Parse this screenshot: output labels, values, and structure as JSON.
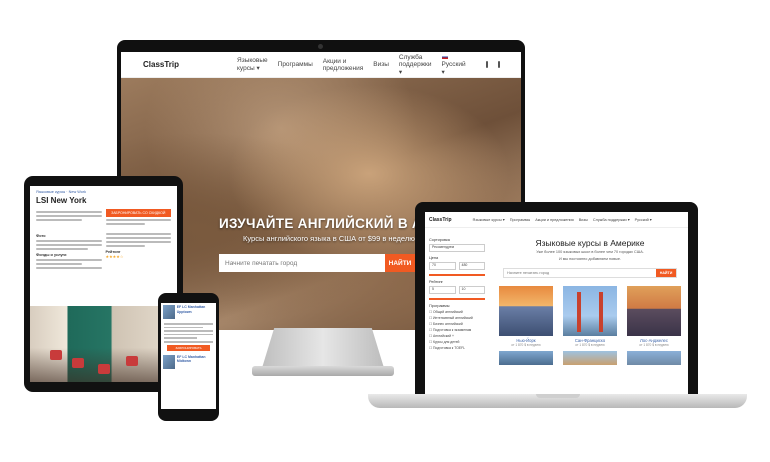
{
  "desktop": {
    "nav": {
      "logo": "ClassTrip",
      "items": [
        "Языковые курсы ▾",
        "Программы",
        "Акции и предложения",
        "Визы",
        "Служба поддержки ▾"
      ],
      "language": "Русский ▾"
    },
    "hero": {
      "title": "ИЗУЧАЙТЕ АНГЛИЙСКИЙ В АМЕРИКЕ",
      "subtitle": "Курсы английского языка в США от $99 в неделю",
      "search_placeholder": "Начните печатать город",
      "search_button": "НАЙТИ"
    }
  },
  "tablet": {
    "breadcrumb": "Языковые курсы · New Work",
    "title": "LSI New York",
    "cta": "ЗАБРОНИРОВАТЬ СО СКИДКОЙ",
    "section_labels": [
      "Фото",
      "Фонды и услуги",
      "Рейтинг"
    ]
  },
  "phone": {
    "cards": [
      {
        "title": "EF LC Manhattan Upptown"
      },
      {
        "title": "EF LC Manhattan Midtown"
      }
    ],
    "cta": "ЗАБРОНИРОВАТЬ"
  },
  "laptop": {
    "nav": {
      "logo": "ClassTrip",
      "items": [
        "Языковые курсы ▾",
        "Программы",
        "Акции и предложения",
        "Визы",
        "Служба поддержки ▾"
      ],
      "language": "Русский ▾"
    },
    "filters": {
      "sort_label": "Сортировка",
      "sort_value": "Рекомендуем",
      "price_label": "Цена",
      "price_min": "70",
      "price_max": "480",
      "rating_label": "Рейтинг",
      "rating_min": "5",
      "rating_max": "10",
      "programs_label": "Программы",
      "programs": [
        "Общий английский",
        "Интенсивный английский",
        "Бизнес английский",
        "Подготовка к экзаменам",
        "Английский +",
        "Курсы для детей",
        "Подготовка к TOEFL"
      ]
    },
    "heading": "Языковые курсы в Америке",
    "subheading": "Уже более 100 языковых школ в более чем 70 городах США.",
    "subheading2": "И мы постоянно добавляем новые.",
    "search_placeholder": "Начните печатать город",
    "search_button": "НАЙТИ",
    "cities": [
      {
        "name": "Нью-Йорк",
        "meta": "от 1 870 $ в неделю"
      },
      {
        "name": "Сан-Франциско",
        "meta": "от 1 870 $ в неделю"
      },
      {
        "name": "Лос-Анджелес",
        "meta": "от 1 870 $ в неделю"
      }
    ]
  },
  "colors": {
    "accent": "#f15a22",
    "link": "#3a62a8"
  }
}
